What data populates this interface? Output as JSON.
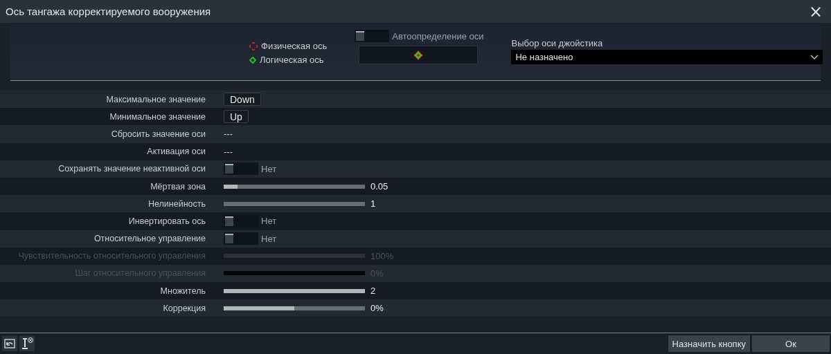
{
  "window": {
    "title": "Ось тангажа корректируемого вооружения",
    "close": "×"
  },
  "axis_panel": {
    "legend": [
      {
        "kind": "physical",
        "label": "Физическая ось"
      },
      {
        "kind": "logical",
        "label": "Логическая ось"
      }
    ],
    "auto_detect": {
      "label": "Автоопределение оси",
      "on": false
    },
    "joystick_axis": {
      "label": "Выбор оси джойстика",
      "value": "Не назначено"
    }
  },
  "rows": [
    {
      "kind": "key",
      "label": "Максимальное значение",
      "value": "Down",
      "disabled": false
    },
    {
      "kind": "key",
      "label": "Минимальное значение",
      "value": "Up",
      "disabled": false
    },
    {
      "kind": "text",
      "label": "Сбросить значение оси",
      "value": "---",
      "disabled": false
    },
    {
      "kind": "text",
      "label": "Активация оси",
      "value": "---",
      "disabled": false
    },
    {
      "kind": "toggle",
      "label": "Сохранять значение неактивной оси",
      "value": "Нет",
      "on": false,
      "disabled": false
    },
    {
      "kind": "slider",
      "label": "Мёртвая зона",
      "value": "0.05",
      "level": 0.1,
      "disabled": false
    },
    {
      "kind": "slider",
      "label": "Нелинейность",
      "value": "1",
      "disabled": false
    },
    {
      "kind": "toggle",
      "label": "Инвертировать ось",
      "value": "Нет",
      "on": false,
      "disabled": false
    },
    {
      "kind": "toggle",
      "label": "Относительное управление",
      "value": "Нет",
      "on": false,
      "disabled": false
    },
    {
      "kind": "slider",
      "label": "Чувствительность относительного управления",
      "value": "100%",
      "disabled": true
    },
    {
      "kind": "slider",
      "label": "Шаг относительного управления",
      "value": "0%",
      "disabled": true
    },
    {
      "kind": "slider",
      "label": "Множитель",
      "value": "2",
      "level": 1,
      "disabled": false
    },
    {
      "kind": "slider",
      "label": "Коррекция",
      "value": "0%",
      "level": 0.5,
      "disabled": false
    }
  ],
  "footer": {
    "buttons": [
      "Назначить кнопку",
      "Ок"
    ]
  }
}
